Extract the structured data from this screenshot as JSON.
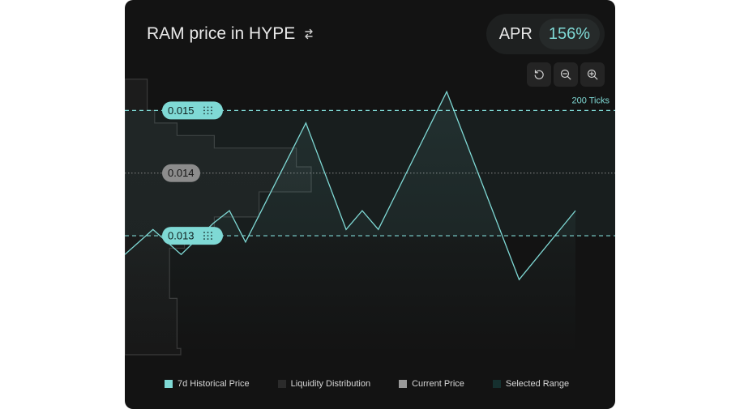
{
  "header": {
    "title": "RAM price in HYPE",
    "apr_label": "APR",
    "apr_value": "156%"
  },
  "toolbar": {
    "icons": [
      "reset-icon",
      "zoom-out-icon",
      "zoom-in-icon"
    ]
  },
  "chart_data": {
    "type": "line",
    "title": "RAM price in HYPE",
    "ylim": [
      0.0111,
      0.0156
    ],
    "series": [
      {
        "name": "7d Historical Price",
        "color": "#7fd9d5",
        "x": [
          0,
          7,
          14,
          22,
          26,
          30,
          45,
          55,
          59,
          63,
          80,
          98,
          112
        ],
        "values": [
          0.0127,
          0.0131,
          0.0127,
          0.0132,
          0.0134,
          0.0129,
          0.0148,
          0.0131,
          0.0134,
          0.0131,
          0.0153,
          0.0123,
          0.0134
        ]
      }
    ],
    "upper_bound": {
      "value": 0.015,
      "label": "0.015"
    },
    "lower_bound": {
      "value": 0.013,
      "label": "0.013"
    },
    "current_price": {
      "value": 0.014,
      "label": "0.014"
    },
    "range_ticks_label": "200 Ticks",
    "liquidity_distribution": {
      "prices": [
        0.0155,
        0.015,
        0.0148,
        0.0146,
        0.0144,
        0.0141,
        0.0137,
        0.0133,
        0.013,
        0.0128,
        0.0124,
        0.012,
        0.0112
      ],
      "depth": [
        0.06,
        0.08,
        0.14,
        0.24,
        0.46,
        0.5,
        0.36,
        0.24,
        0.16,
        0.12,
        0.12,
        0.14,
        0.15
      ]
    },
    "grid": false,
    "legend_position": "bottom",
    "legend": [
      {
        "label": "7d Historical Price",
        "color": "#7fd9d5"
      },
      {
        "label": "Liquidity Distribution",
        "color": "#2b2b2b"
      },
      {
        "label": "Current Price",
        "color": "#9a9a9a"
      },
      {
        "label": "Selected Range",
        "color": "#16302f"
      }
    ]
  }
}
